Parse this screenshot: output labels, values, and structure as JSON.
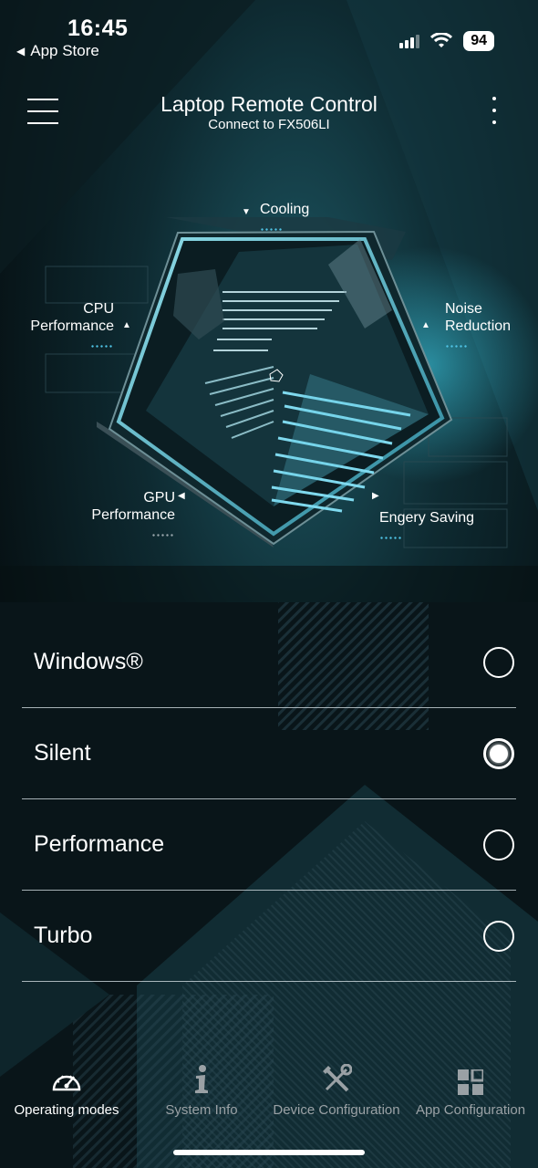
{
  "status_bar": {
    "time": "16:45",
    "back_label": "App Store",
    "battery": "94"
  },
  "header": {
    "title": "Laptop Remote Control",
    "subtitle": "Connect to FX506LI"
  },
  "radar": {
    "cooling": "Cooling",
    "cpu_line1": "CPU",
    "cpu_line2": "Performance",
    "noise_line1": "Noise",
    "noise_line2": "Reduction",
    "gpu_line1": "GPU",
    "gpu_line2": "Performance",
    "energy": "Engery Saving"
  },
  "modes": [
    {
      "label": "Windows®",
      "selected": false
    },
    {
      "label": "Silent",
      "selected": true
    },
    {
      "label": "Performance",
      "selected": false
    },
    {
      "label": "Turbo",
      "selected": false
    }
  ],
  "tabs": [
    {
      "label": "Operating modes",
      "icon": "gauge-icon",
      "active": true
    },
    {
      "label": "System Info",
      "icon": "info-icon",
      "active": false
    },
    {
      "label": "Device Configuration",
      "icon": "tools-icon",
      "active": false
    },
    {
      "label": "App Configuration",
      "icon": "grid-icon",
      "active": false
    }
  ],
  "colors": {
    "accent": "#4fc4e6",
    "background": "#071014",
    "inactive_tab": "#9aa1a5"
  }
}
